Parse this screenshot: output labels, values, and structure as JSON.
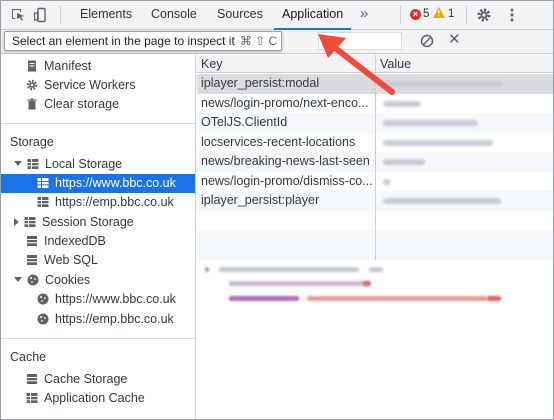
{
  "toolbar": {
    "tabs": [
      {
        "label": "Elements"
      },
      {
        "label": "Console"
      },
      {
        "label": "Sources"
      },
      {
        "label": "Application"
      }
    ],
    "more_label": "»",
    "error_count": "5",
    "warning_count": "1",
    "active_tab": "Application",
    "accent_color": "#1a73e8"
  },
  "tooltip": {
    "text": "Select an element in the page to inspect it",
    "shortcut": "⌘ ⇧ C"
  },
  "sidebar": {
    "app_items": [
      {
        "label": "Manifest",
        "icon": "manifest-icon"
      },
      {
        "label": "Service Workers",
        "icon": "gear-icon"
      },
      {
        "label": "Clear storage",
        "icon": "trash-icon"
      }
    ],
    "storage_header": "Storage",
    "storage_items": [
      {
        "label": "Local Storage",
        "icon": "grid-icon"
      },
      {
        "label": "https://www.bbc.co.uk",
        "icon": "grid-icon"
      },
      {
        "label": "https://emp.bbc.co.uk",
        "icon": "grid-icon"
      },
      {
        "label": "Session Storage",
        "icon": "grid-icon"
      },
      {
        "label": "IndexedDB",
        "icon": "database-icon"
      },
      {
        "label": "Web SQL",
        "icon": "database-icon"
      },
      {
        "label": "Cookies",
        "icon": "cookie-icon"
      },
      {
        "label": "https://www.bbc.co.uk",
        "icon": "cookie-icon"
      },
      {
        "label": "https://emp.bbc.co.uk",
        "icon": "cookie-icon"
      }
    ],
    "cache_header": "Cache",
    "cache_items": [
      {
        "label": "Cache Storage",
        "icon": "database-icon"
      },
      {
        "label": "Application Cache",
        "icon": "grid-icon"
      }
    ]
  },
  "table": {
    "columns": [
      "Key",
      "Value"
    ],
    "rows": [
      {
        "key": "iplayer_persist:modal"
      },
      {
        "key": "news/login-promo/next-enco..."
      },
      {
        "key": "OTelJS.ClientId"
      },
      {
        "key": "locservices-recent-locations"
      },
      {
        "key": "news/breaking-news-last-seen"
      },
      {
        "key": "news/login-promo/dismiss-co..."
      },
      {
        "key": "iplayer_persist:player"
      }
    ]
  }
}
